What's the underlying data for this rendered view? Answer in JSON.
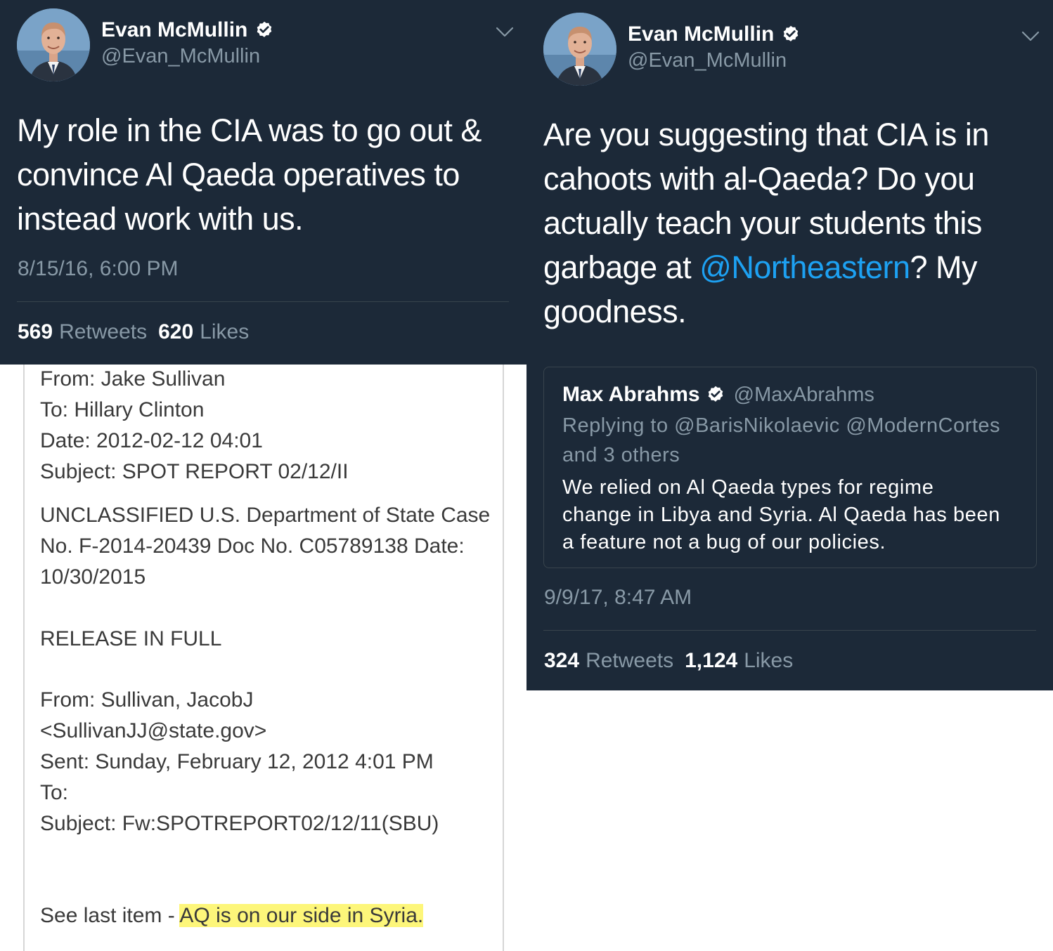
{
  "left_tweet": {
    "author_name": "Evan McMullin",
    "author_handle": "@Evan_McMullin",
    "text_lines": [
      "My role in the CIA was to go out &",
      "convince Al Qaeda operatives to",
      "instead work with us."
    ],
    "timestamp": "8/15/16, 6:00 PM",
    "retweets_count": "569",
    "retweets_label": "Retweets",
    "likes_count": "620",
    "likes_label": "Likes"
  },
  "right_tweet": {
    "author_name": "Evan McMullin",
    "author_handle": "@Evan_McMullin",
    "text_lines": [
      "Are you suggesting that CIA is in",
      "cahoots with al-Qaeda? Do you",
      "actually teach your students this"
    ],
    "text_line4_before": "garbage at ",
    "text_line4_mention": "@Northeastern",
    "text_line4_after": "? My",
    "text_line5": "goodness.",
    "quoted": {
      "author_name": "Max Abrahms",
      "author_handle": "@MaxAbrahms",
      "reply_line1": "Replying to @BarisNikolaevic @ModernCortes",
      "reply_line2": "and 3 others",
      "body_lines": [
        "We relied on Al Qaeda types for regime",
        "change in Libya and Syria. Al Qaeda has been",
        "a feature not a bug of our policies."
      ]
    },
    "timestamp": "9/9/17, 8:47 AM",
    "retweets_count": "324",
    "retweets_label": "Retweets",
    "likes_count": "1,124",
    "likes_label": "Likes"
  },
  "email": {
    "from": "From: Jake Sullivan",
    "to": "To: Hillary Clinton",
    "date": "Date: 2012-02-12 04:01",
    "subject": "Subject: SPOT REPORT 02/12/II",
    "header_line1": "UNCLASSIFIED U.S. Department of State Case",
    "header_line2": "No. F-2014-20439 Doc No. C05789138 Date:",
    "header_line3": "10/30/2015",
    "release": "RELEASE IN FULL",
    "from2_line1": "From: Sullivan, JacobJ",
    "from2_line2": "<SullivanJJ@state.gov>",
    "sent": "Sent: Sunday, February 12, 2012 4:01 PM",
    "to2": "To:",
    "subject2": "Subject: Fw:SPOTREPORT02/12/11(SBU)",
    "last_prefix": "See last item - ",
    "last_highlight": "AQ is on our side in Syria."
  },
  "colors": {
    "tweet_background": "#1c2938",
    "secondary_text": "#8899a6",
    "mention": "#1da1f2",
    "highlight": "#fdf67a"
  },
  "icons": [
    "verified-badge-icon",
    "chevron-down-icon"
  ]
}
